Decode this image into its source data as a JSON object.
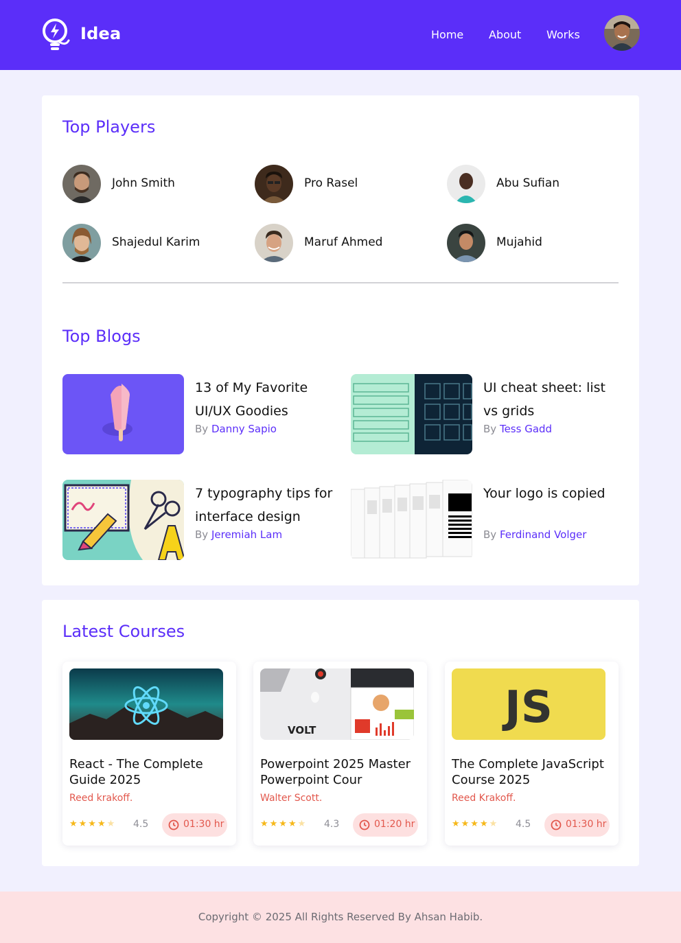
{
  "header": {
    "brand": "Idea",
    "nav": [
      "Home",
      "About",
      "Works"
    ],
    "accent_color": "#5b2ef9"
  },
  "top_players": {
    "title": "Top Players",
    "players": [
      {
        "name": "John Smith"
      },
      {
        "name": "Pro Rasel"
      },
      {
        "name": "Abu Sufian"
      },
      {
        "name": "Shajedul Karim"
      },
      {
        "name": "Maruf Ahmed"
      },
      {
        "name": "Mujahid"
      }
    ]
  },
  "top_blogs": {
    "title": "Top Blogs",
    "by_label": "By",
    "blogs": [
      {
        "title": "13 of My Favorite UI/UX Goodies",
        "author": "Danny Sapio"
      },
      {
        "title": "UI cheat sheet: list vs grids",
        "author": "Tess Gadd"
      },
      {
        "title": "7 typography tips for interface design",
        "author": "Jeremiah Lam"
      },
      {
        "title": "Your logo is copied",
        "author": "Ferdinand Volger"
      }
    ]
  },
  "latest_courses": {
    "title": "Latest Courses",
    "courses": [
      {
        "title": "React - The Complete Guide 2025",
        "author": "Reed krakoff.",
        "stars": "★★★★",
        "star_dim": "★",
        "rating": "4.5",
        "duration": "01:30 hr"
      },
      {
        "title": "Powerpoint 2025 Master Powerpoint Cour",
        "author": "Walter Scott.",
        "stars": "★★★★",
        "star_dim": "★",
        "rating": "4.3",
        "duration": "01:20 hr"
      },
      {
        "title": "The Complete JavaScript Course 2025",
        "author": "Reed Krakoff.",
        "stars": "★★★★",
        "star_dim": "★",
        "rating": "4.5",
        "duration": "01:30 hr"
      }
    ],
    "image_labels": {
      "volt": "VOLT",
      "js": "JS"
    }
  },
  "footer": {
    "copyright": "Copyright © 2025 All Rights Reserved By Ahsan Habib."
  }
}
